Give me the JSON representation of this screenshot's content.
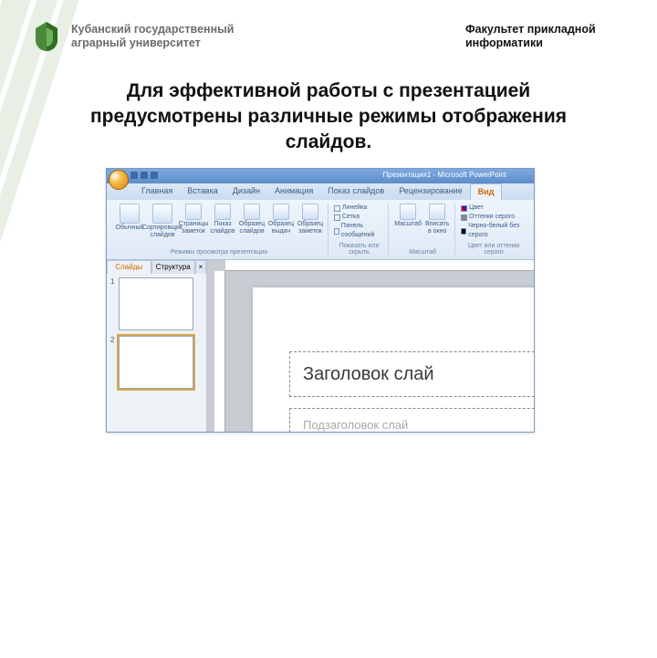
{
  "header": {
    "university_line1": "Кубанский государственный",
    "university_line2": "аграрный университет",
    "faculty_line1": "Факультет прикладной",
    "faculty_line2": "информатики"
  },
  "title": "Для эффективной работы с презентацией предусмотрены различные режимы отображения слайдов.",
  "powerpoint": {
    "window_title": "Презентация1 - Microsoft PowerPoint",
    "tabs": [
      "Главная",
      "Вставка",
      "Дизайн",
      "Анимация",
      "Показ слайдов",
      "Рецензирование",
      "Вид"
    ],
    "active_tab": "Вид",
    "groups": {
      "views": {
        "items": [
          "Обычный",
          "Сортировщик слайдов",
          "Страницы заметок",
          "Показ слайдов",
          "Образец слайдов",
          "Образец выдач",
          "Образец заметок"
        ],
        "label": "Режимы просмотра презентации"
      },
      "show": {
        "checks": [
          "Линейка",
          "Сетка",
          "Панель сообщений"
        ],
        "label": "Показать или скрыть"
      },
      "zoom": {
        "items": [
          "Масштаб",
          "Вписать в окно"
        ],
        "label": "Масштаб"
      },
      "color": {
        "items": [
          "Цвет",
          "Оттенки серого",
          "Черно-белый без серого"
        ],
        "label": "Цвет или оттенки серого"
      }
    },
    "panel": {
      "tab_slides": "Слайды",
      "tab_outline": "Структура",
      "num1": "1",
      "num2": "2"
    },
    "placeholders": {
      "title": "Заголовок слай",
      "subtitle": "Подзаголовок слай"
    }
  }
}
